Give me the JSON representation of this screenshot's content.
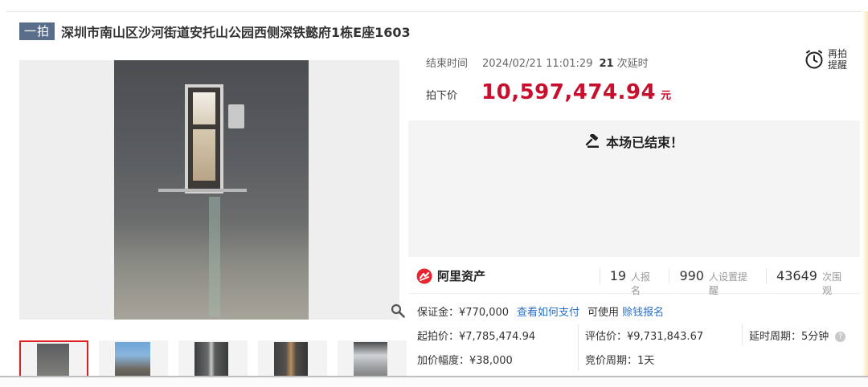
{
  "header": {
    "tag": "一拍",
    "title": "深圳市南山区沙河街道安托山公园西侧深铁懿府1栋E座1603"
  },
  "timing": {
    "end_label": "结束时间",
    "end_value": "2024/02/21 11:01:29",
    "delay_count": "21",
    "delay_label": "次延时"
  },
  "price": {
    "label": "拍下价",
    "value": "10,597,474.94",
    "unit": "元"
  },
  "remind": {
    "line1": "再拍",
    "line2": "提醒",
    "icon": "alarm-clock-icon"
  },
  "status": {
    "text": "本场已结束！",
    "icon": "gavel-icon"
  },
  "stats": {
    "brand": "阿里资产",
    "registered_num": "19",
    "registered_label": "人报名",
    "reminders_num": "990",
    "reminders_label": "人设置提醒",
    "views_num": "43649",
    "views_label": "次围观"
  },
  "deposit": {
    "text": "保证金：¥770,000",
    "how_to_pay": "查看如何支付",
    "usable": "可使用",
    "earn_link": "赊钱报名"
  },
  "details": {
    "start_price": "起拍价：¥7,785,474.94",
    "appraisal": "评估价：¥9,731,843.67",
    "delay_period": "延时周期：5分钟",
    "increment": "加价幅度：¥38,000",
    "bid_period": "竞价周期：1天"
  },
  "colors": {
    "price_red": "#c8102e",
    "link_blue": "#2a6fc9",
    "tag_bg": "#5a6e8c"
  }
}
